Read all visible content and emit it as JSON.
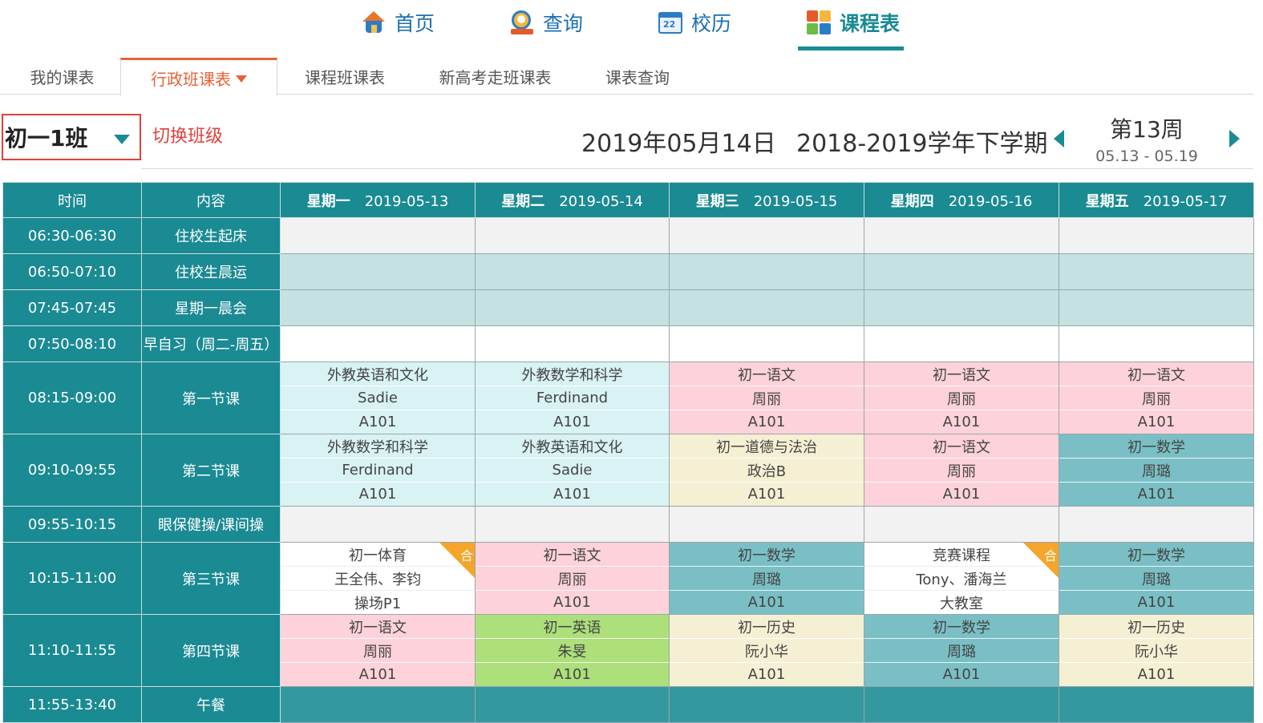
{
  "nav": {
    "items": [
      {
        "label": "首页",
        "icon": "home-icon"
      },
      {
        "label": "查询",
        "icon": "search-icon"
      },
      {
        "label": "校历",
        "icon": "calendar-icon"
      },
      {
        "label": "课程表",
        "icon": "timetable-icon"
      }
    ],
    "active": "课程表"
  },
  "tabs": {
    "items": [
      "我的课表",
      "行政班课表",
      "课程班课表",
      "新高考走班课表",
      "课表查询"
    ],
    "active": "行政班课表"
  },
  "header": {
    "class_name": "初一1班",
    "switch_label": "切换班级",
    "date": "2019年05月14日",
    "term": "2018-2019学年下学期",
    "week": "第13周",
    "week_range": "05.13 - 05.19"
  },
  "table": {
    "col_time": "时间",
    "col_content": "内容",
    "days": [
      {
        "dow": "星期一",
        "date": "2019-05-13"
      },
      {
        "dow": "星期二",
        "date": "2019-05-14"
      },
      {
        "dow": "星期三",
        "date": "2019-05-15"
      },
      {
        "dow": "星期四",
        "date": "2019-05-16"
      },
      {
        "dow": "星期五",
        "date": "2019-05-17"
      }
    ],
    "rows": [
      {
        "time": "06:30-06:30",
        "content": "住校生起床"
      },
      {
        "time": "06:50-07:10",
        "content": "住校生晨运"
      },
      {
        "time": "07:45-07:45",
        "content": "星期一晨会"
      },
      {
        "time": "07:50-08:10",
        "content": "早自习（周二-周五）"
      },
      {
        "time": "08:15-09:00",
        "content": "第一节课",
        "cells": [
          {
            "course": "外教英语和文化",
            "teacher": "Sadie",
            "room": "A101"
          },
          {
            "course": "外教数学和科学",
            "teacher": "Ferdinand",
            "room": "A101"
          },
          {
            "course": "初一语文",
            "teacher": "周丽",
            "room": "A101"
          },
          {
            "course": "初一语文",
            "teacher": "周丽",
            "room": "A101"
          },
          {
            "course": "初一语文",
            "teacher": "周丽",
            "room": "A101"
          }
        ]
      },
      {
        "time": "09:10-09:55",
        "content": "第二节课",
        "cells": [
          {
            "course": "外教数学和科学",
            "teacher": "Ferdinand",
            "room": "A101"
          },
          {
            "course": "外教英语和文化",
            "teacher": "Sadie",
            "room": "A101"
          },
          {
            "course": "初一道德与法治",
            "teacher": "政治B",
            "room": "A101"
          },
          {
            "course": "初一语文",
            "teacher": "周丽",
            "room": "A101"
          },
          {
            "course": "初一数学",
            "teacher": "周璐",
            "room": "A101"
          }
        ]
      },
      {
        "time": "09:55-10:15",
        "content": "眼保健操/课间操"
      },
      {
        "time": "10:15-11:00",
        "content": "第三节课",
        "cells": [
          {
            "course": "初一体育",
            "teacher": "王全伟、李钧",
            "room": "操场P1",
            "badge": "合"
          },
          {
            "course": "初一语文",
            "teacher": "周丽",
            "room": "A101"
          },
          {
            "course": "初一数学",
            "teacher": "周璐",
            "room": "A101"
          },
          {
            "course": "竞赛课程",
            "teacher": "Tony、潘海兰",
            "room": "大教室",
            "badge": "合"
          },
          {
            "course": "初一数学",
            "teacher": "周璐",
            "room": "A101"
          }
        ]
      },
      {
        "time": "11:10-11:55",
        "content": "第四节课",
        "cells": [
          {
            "course": "初一语文",
            "teacher": "周丽",
            "room": "A101"
          },
          {
            "course": "初一英语",
            "teacher": "朱旻",
            "room": "A101"
          },
          {
            "course": "初一历史",
            "teacher": "阮小华",
            "room": "A101"
          },
          {
            "course": "初一数学",
            "teacher": "周璐",
            "room": "A101"
          },
          {
            "course": "初一历史",
            "teacher": "阮小华",
            "room": "A101"
          }
        ]
      },
      {
        "time": "11:55-13:40",
        "content": "午餐"
      }
    ]
  },
  "colors": {
    "accent": "#1a8a93",
    "tab_active": "#e8623a",
    "highlight_box": "#e0403a",
    "chinese": "#fdd2da",
    "math": "#7abfc5",
    "foreign": "#d9f2f4",
    "ethics_history": "#f5f0d4",
    "english": "#addf7b",
    "merged_badge": "#f4a52a"
  }
}
